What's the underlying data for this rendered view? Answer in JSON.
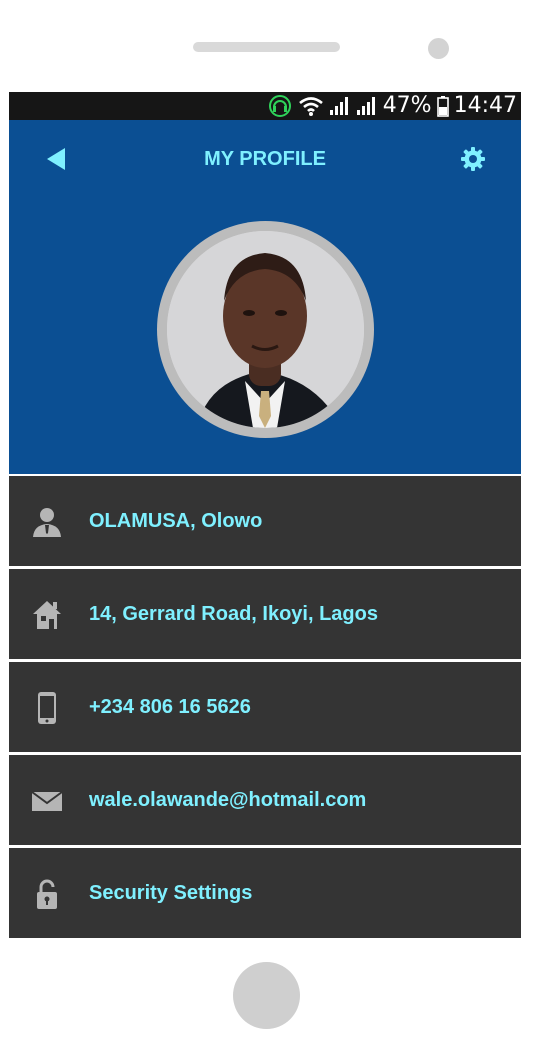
{
  "status_bar": {
    "battery": "47%",
    "time": "14:47"
  },
  "header": {
    "title": "MY PROFILE"
  },
  "profile": {
    "name": "OLAMUSA, Olowo",
    "address": "14, Gerrard Road, Ikoyi, Lagos",
    "phone": "+234 806 16 5626",
    "email": "wale.olawande@hotmail.com",
    "security": "Security Settings"
  },
  "colors": {
    "header_bg": "#0b4f93",
    "accent_text": "#7ff0ff",
    "row_bg": "#343434",
    "icon_gray": "#b5b5b5",
    "status_bar_bg": "#161616"
  },
  "icons": {
    "back": "back-arrow-icon",
    "settings": "gear-icon",
    "name": "person-icon",
    "address": "house-icon",
    "phone": "mobile-phone-icon",
    "email": "envelope-icon",
    "security": "padlock-icon"
  }
}
